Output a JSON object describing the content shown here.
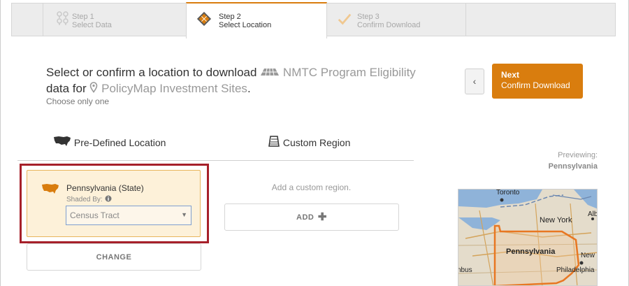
{
  "steps": [
    {
      "number": "Step 1",
      "label": "Select Data",
      "icon": "map-pins-icon"
    },
    {
      "number": "Step 2",
      "label": "Select Location",
      "icon": "layers-icon"
    },
    {
      "number": "Step 3",
      "label": "Confirm Download",
      "icon": "checkmark-icon"
    }
  ],
  "heading": {
    "prefix": "Select or confirm a location to download",
    "dataset": "NMTC Program Eligibility",
    "middle": "data for",
    "site": "PolicyMap Investment Sites",
    "suffix": ".",
    "subtitle": "Choose only one"
  },
  "nav": {
    "back_label": "‹",
    "next_title": "Next",
    "next_subtitle": "Confirm Download"
  },
  "tabs": {
    "predefined": "Pre-Defined Location",
    "custom": "Custom Region"
  },
  "location": {
    "title": "Pennsylvania (State)",
    "shaded_by_label": "Shaded By:",
    "shaded_by_value": "Census Tract",
    "change_label": "CHANGE"
  },
  "custom": {
    "hint": "Add a custom region.",
    "add_label": "ADD"
  },
  "preview": {
    "label": "Previewing:",
    "name": "Pennsylvania",
    "map_labels": {
      "toronto": "Toronto",
      "alb": "Alb",
      "new_york": "New York",
      "pennsylvania": "Pennsylvania",
      "new": "New",
      "nbus": "nbus",
      "philadelphia": "Philadelphia"
    }
  },
  "colors": {
    "accent": "#d97d0e",
    "highlight_border": "#a6202a",
    "card_bg": "#fdf1d9"
  }
}
